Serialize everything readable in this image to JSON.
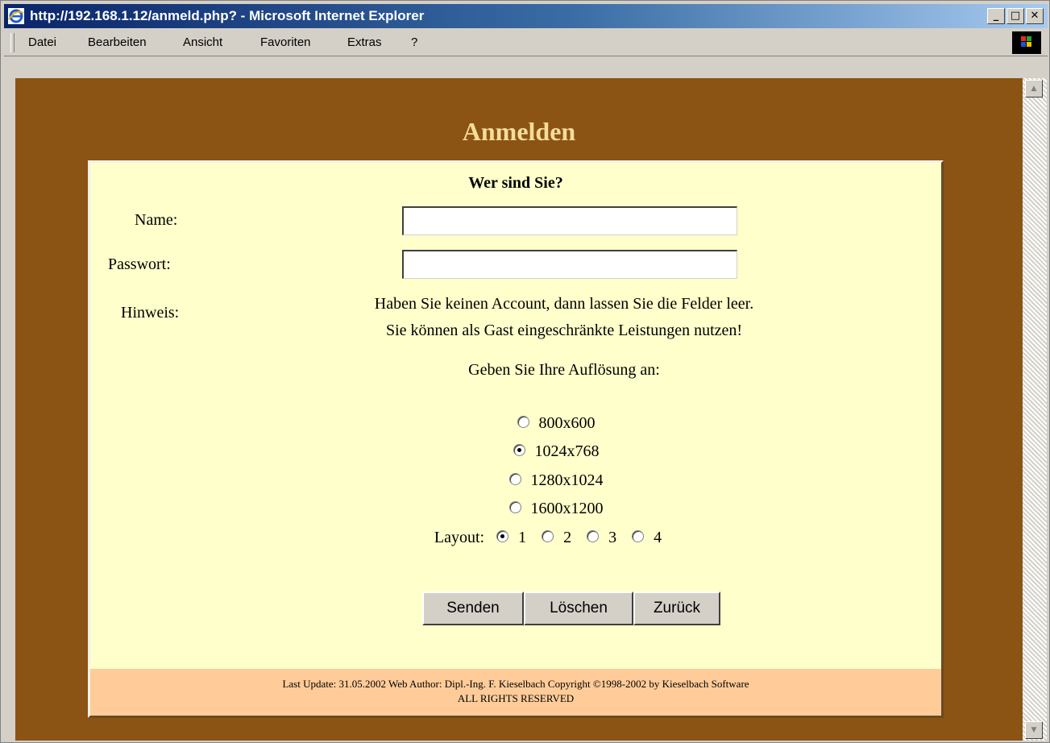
{
  "window": {
    "title": "http://192.168.1.12/anmeld.php? - Microsoft Internet Explorer"
  },
  "menu": {
    "items": [
      "Datei",
      "Bearbeiten",
      "Ansicht",
      "Favoriten",
      "Extras",
      "?"
    ]
  },
  "page": {
    "heading": "Anmelden"
  },
  "form": {
    "title": "Wer sind Sie?",
    "name_label": "Name:",
    "name_value": "",
    "password_label": "Passwort:",
    "password_value": "",
    "hint_label": "Hinweis:",
    "hint_line1": "Haben Sie keinen Account, dann lassen Sie die Felder leer.",
    "hint_line2": "Sie können als Gast eingeschränkte Leistungen nutzen!",
    "resolution_prompt": "Geben Sie Ihre Auflösung an:",
    "resolutions": [
      "800x600",
      "1024x768",
      "1280x1024",
      "1600x1200"
    ],
    "resolution_selected": "1024x768",
    "layout_label": "Layout:",
    "layouts": [
      "1",
      "2",
      "3",
      "4"
    ],
    "layout_selected": "1",
    "buttons": {
      "send": "Senden",
      "clear": "Löschen",
      "back": "Zurück"
    }
  },
  "footer": {
    "line1": "Last Update: 31.05.2002 Web Author: Dipl.-Ing. F. Kieselbach Copyright ©1998-2002 by Kieselbach Software",
    "line2": "ALL RIGHTS RESERVED"
  },
  "colors": {
    "page_bg": "#8b5414",
    "panel_bg": "#ffffcc",
    "footer_bg": "#ffcc99",
    "heading": "#f4dc9a"
  }
}
